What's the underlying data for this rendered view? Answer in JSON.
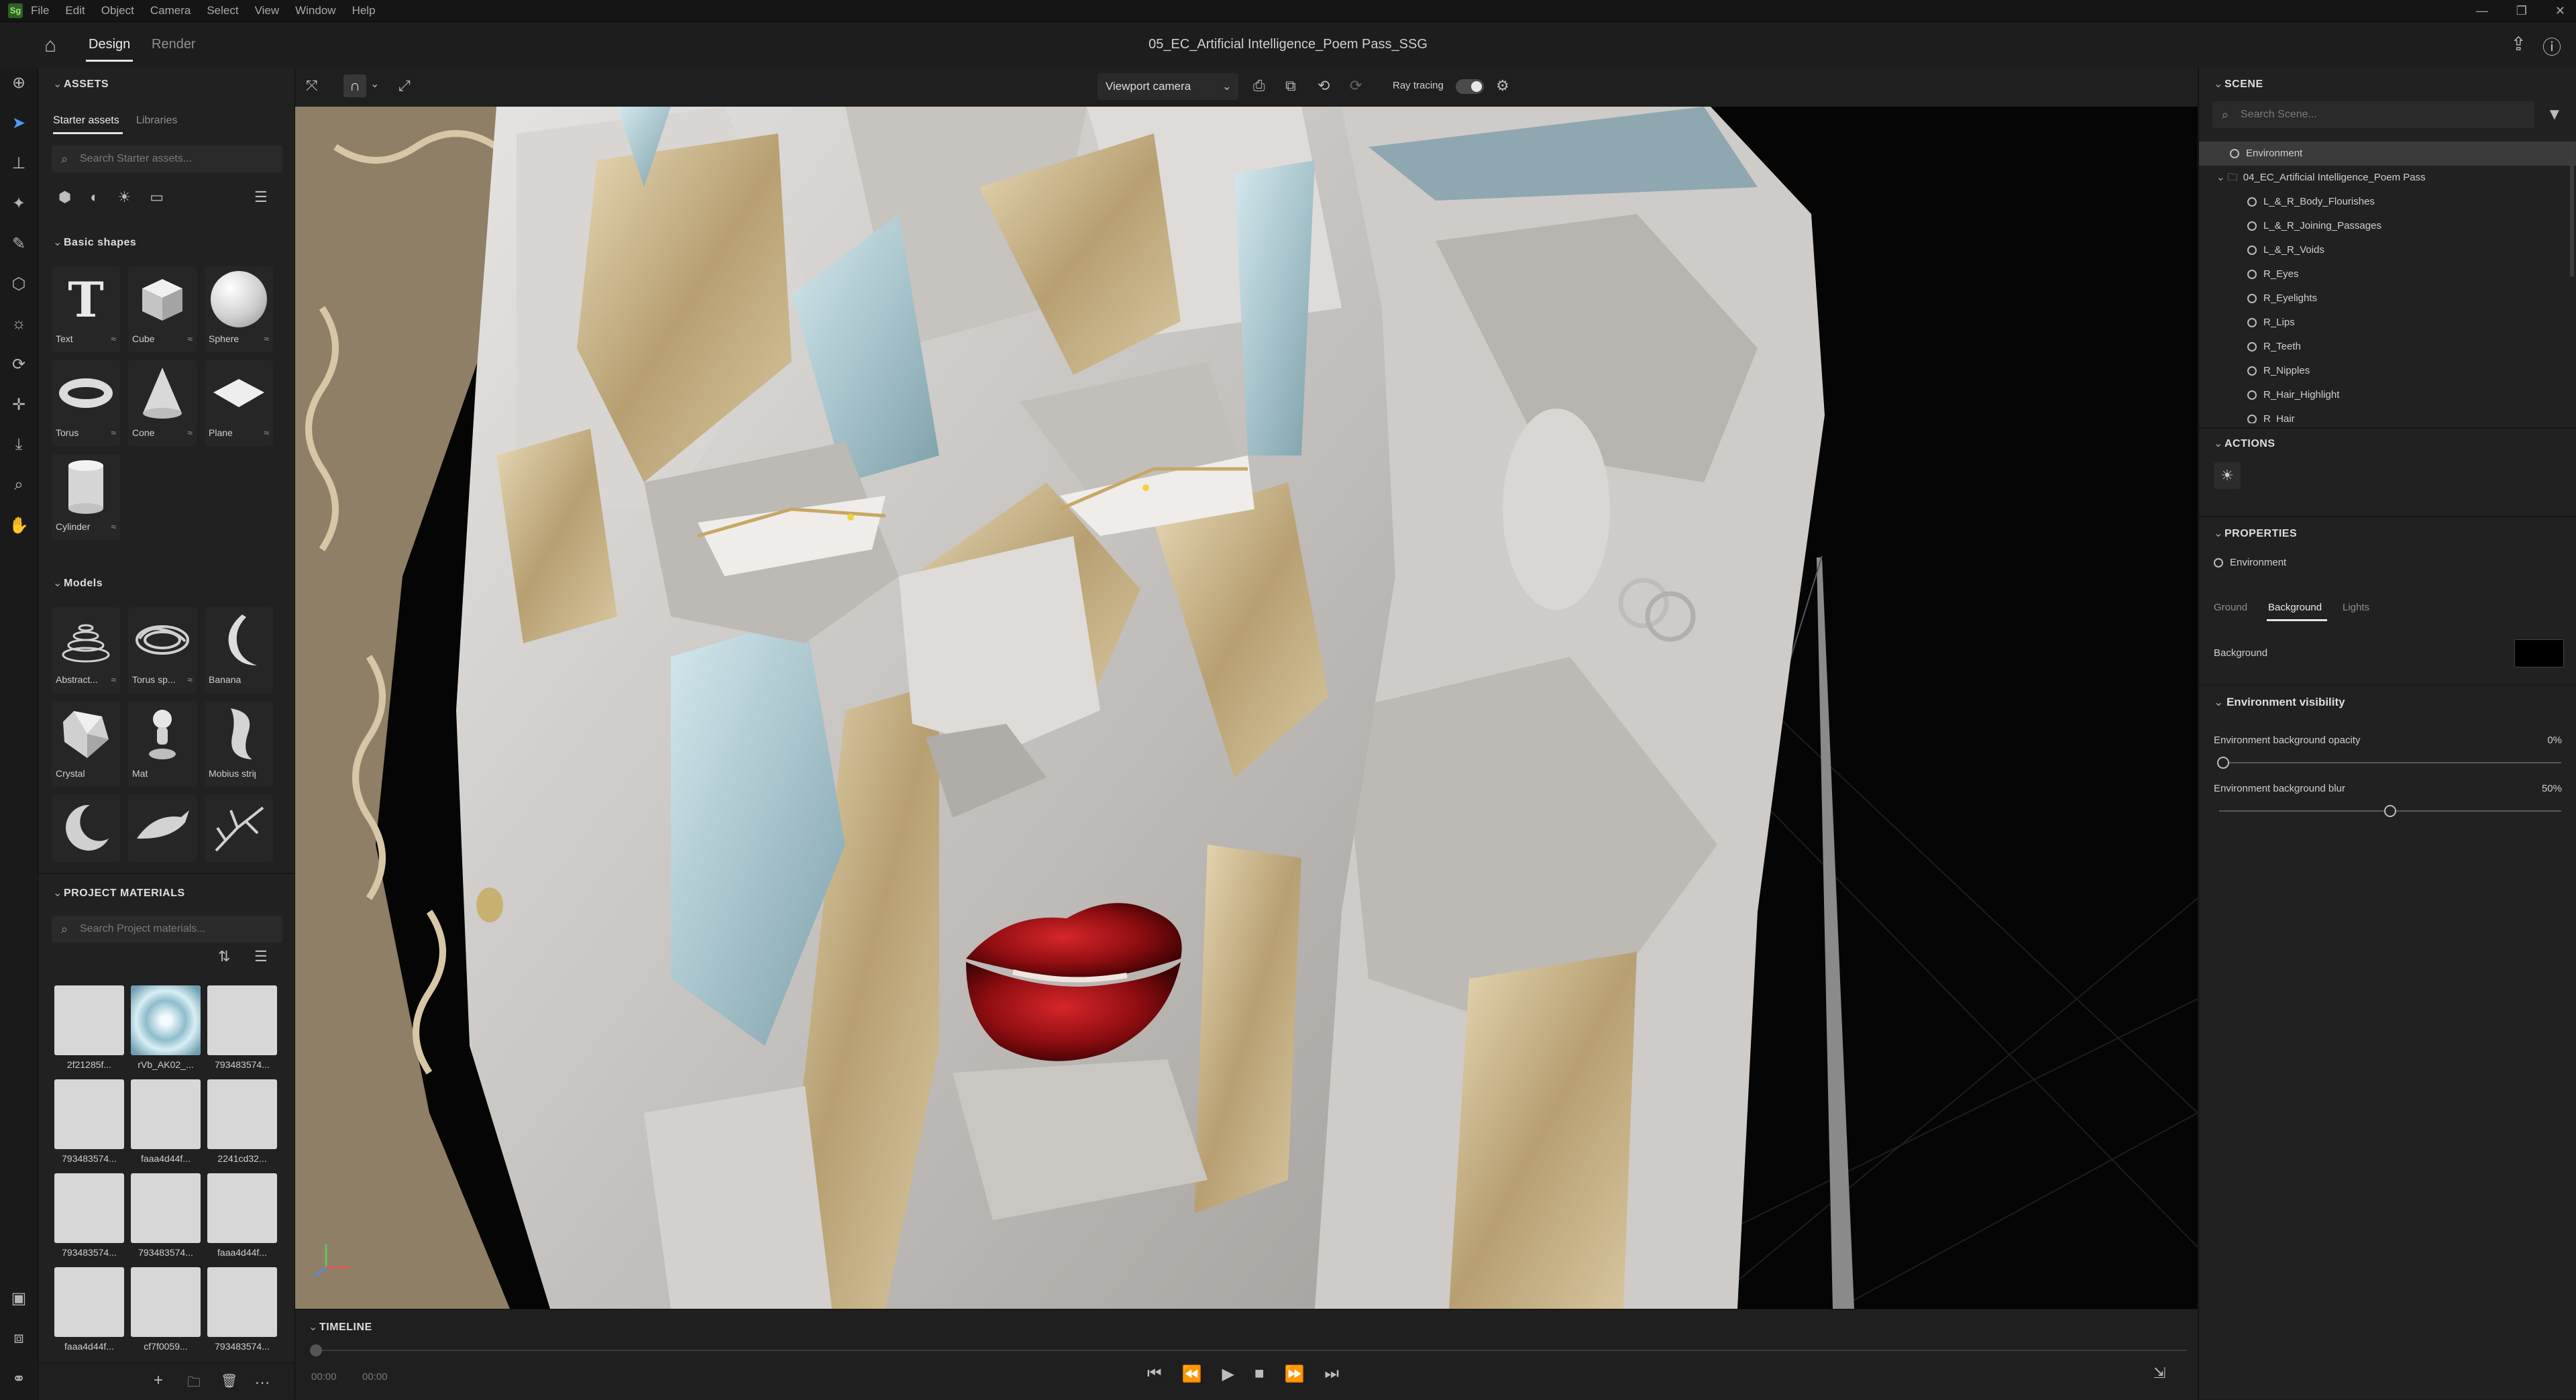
{
  "app": {
    "menu": [
      "File",
      "Edit",
      "Object",
      "Camera",
      "Select",
      "View",
      "Window",
      "Help"
    ],
    "window_controls": [
      "—",
      "❐",
      "✕"
    ]
  },
  "header": {
    "tabs": [
      {
        "label": "Design",
        "active": true
      },
      {
        "label": "Render",
        "active": false
      }
    ],
    "document_title": "05_EC_Artificial Intelligence_Poem Pass_SSG"
  },
  "assets": {
    "title": "ASSETS",
    "tabs": [
      "Starter assets",
      "Libraries"
    ],
    "search_placeholder": "Search Starter assets...",
    "basic_shapes": {
      "title": "Basic shapes",
      "items": [
        "Text",
        "Cube",
        "Sphere",
        "Torus",
        "Cone",
        "Plane",
        "Cylinder"
      ]
    },
    "models": {
      "title": "Models",
      "items": [
        "Abstract...",
        "Torus sp...",
        "Banana",
        "Crystal",
        "Mat",
        "Mobius strip"
      ]
    },
    "project_materials": {
      "title": "PROJECT MATERIALS",
      "search_placeholder": "Search Project materials...",
      "items": [
        "2f21285f...",
        "rVb_AK02_...",
        "793483574...",
        "793483574...",
        "faaa4d44f...",
        "2241cd32...",
        "793483574...",
        "793483574...",
        "faaa4d44f...",
        "faaa4d44f...",
        "cf7f0059...",
        "793483574..."
      ]
    }
  },
  "viewport": {
    "camera_select": "Viewport camera",
    "ray_tracing_label": "Ray tracing",
    "ray_tracing_on": true
  },
  "timeline": {
    "title": "TIMELINE",
    "time_current": "00:00",
    "time_end": "00:00"
  },
  "scene": {
    "title": "SCENE",
    "search_placeholder": "Search Scene...",
    "tree": [
      {
        "label": "Environment",
        "selected": true
      },
      {
        "label": "04_EC_Artificial Intelligence_Poem Pass",
        "selected": false
      },
      {
        "label": "L_&_R_Body_Flourishes",
        "selected": false
      },
      {
        "label": "L_&_R_Joining_Passages",
        "selected": false
      },
      {
        "label": "L_&_R_Voids",
        "selected": false
      },
      {
        "label": "R_Eyes",
        "selected": false
      },
      {
        "label": "R_Eyelights",
        "selected": false
      },
      {
        "label": "R_Lips",
        "selected": false
      },
      {
        "label": "R_Teeth",
        "selected": false
      },
      {
        "label": "R_Nipples",
        "selected": false
      },
      {
        "label": "R_Hair_Highlight",
        "selected": false
      },
      {
        "label": "R_Hair",
        "selected": false
      }
    ]
  },
  "actions": {
    "title": "ACTIONS"
  },
  "properties": {
    "title": "PROPERTIES",
    "object": "Environment",
    "tabs": [
      {
        "label": "Ground",
        "active": false
      },
      {
        "label": "Background",
        "active": true
      },
      {
        "label": "Lights",
        "active": false
      }
    ],
    "background_label": "Background",
    "background_color": "#000000",
    "env_visibility": {
      "title": "Environment visibility",
      "opacity_label": "Environment background opacity",
      "opacity_value": "0%",
      "opacity_fraction": 0.0,
      "blur_label": "Environment background blur",
      "blur_value": "50%",
      "blur_fraction": 0.5
    }
  },
  "colors": {
    "accent": "#4b9df2",
    "app_bg": "#1b1b1b",
    "panel_bg": "#212121"
  }
}
